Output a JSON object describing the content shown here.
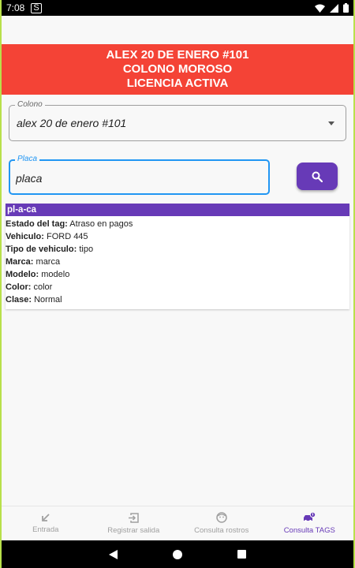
{
  "status_bar": {
    "time": "7:08",
    "sim_icon": "S"
  },
  "banner": {
    "line1": "ALEX 20 DE ENERO #101",
    "line2": "COLONO MOROSO",
    "line3": "LICENCIA ACTIVA",
    "color": "#f44336"
  },
  "colono_field": {
    "label": "Colono",
    "value": "alex 20 de enero #101"
  },
  "placa_field": {
    "label": "Placa",
    "value": "placa",
    "placeholder": ""
  },
  "accent": "#673ab7",
  "result": {
    "header": "pl-a-ca",
    "rows": [
      {
        "key": "Estado del tag:",
        "value": "Atraso en pagos"
      },
      {
        "key": "Vehiculo:",
        "value": "FORD 445"
      },
      {
        "key": "Tipo de vehiculo:",
        "value": "tipo"
      },
      {
        "key": "Marca:",
        "value": "marca"
      },
      {
        "key": "Modelo:",
        "value": "modelo"
      },
      {
        "key": "Color:",
        "value": "color"
      },
      {
        "key": "Clase:",
        "value": "Normal"
      }
    ]
  },
  "bottom_nav": [
    {
      "label": "Entrada",
      "icon": "arrow-down-left-icon"
    },
    {
      "label": "Registrar salida",
      "icon": "exit-icon"
    },
    {
      "label": "Consulta rostros",
      "icon": "face-icon"
    },
    {
      "label": "Consulta TAGS",
      "icon": "car-tag-icon",
      "active": true
    }
  ]
}
